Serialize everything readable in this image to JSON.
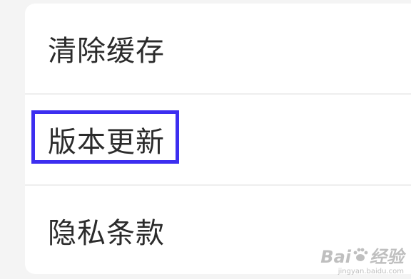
{
  "settings_list": {
    "items": [
      {
        "label": "清除缓存"
      },
      {
        "label": "版本更新",
        "highlighted": true
      },
      {
        "label": "隐私条款"
      }
    ]
  },
  "annotation": {
    "highlight_color": "#3c2ef0"
  },
  "watermark": {
    "brand_left": "Bai",
    "brand_right": "经验",
    "url": "jingyan.baidu.com",
    "icon": "paw-icon"
  }
}
